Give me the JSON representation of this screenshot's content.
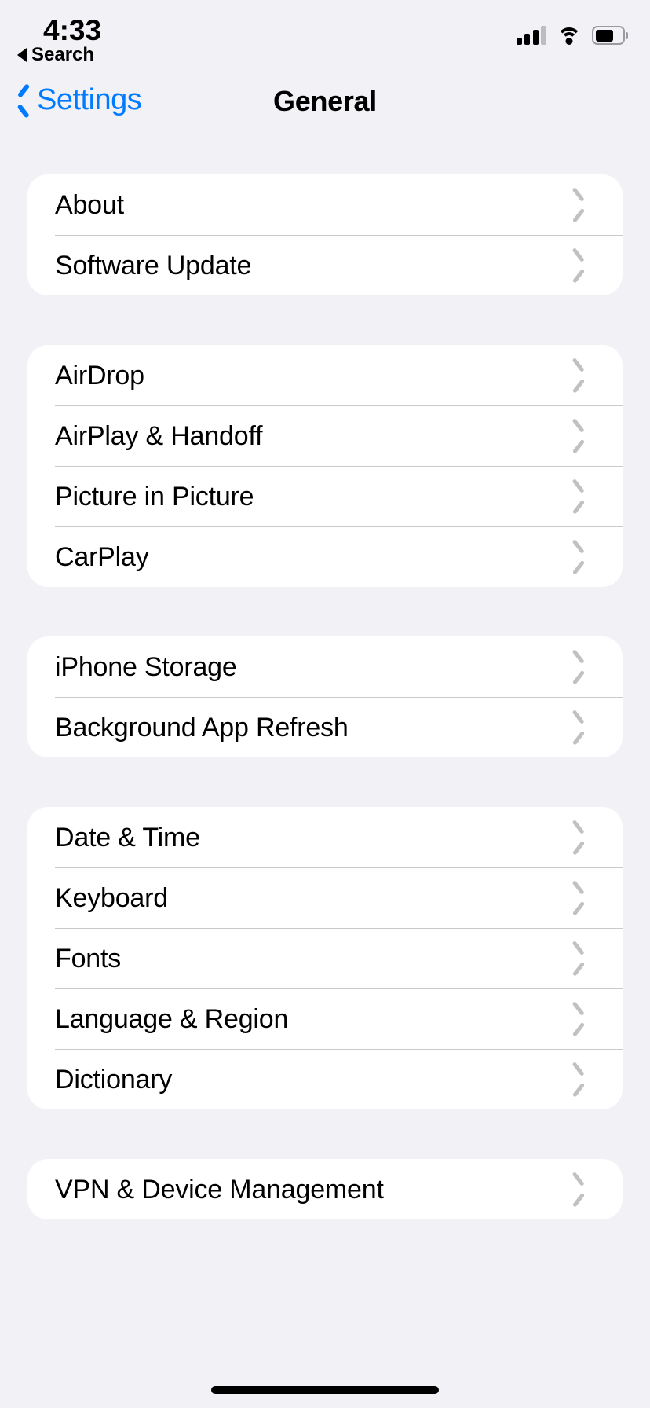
{
  "status_bar": {
    "time": "4:33",
    "back_to_app_label": "Search",
    "back_triangle_icon": "back-triangle-icon",
    "cellular_icon": "cellular-signal-icon",
    "cellular_bars_filled": 3,
    "cellular_bars_total": 4,
    "wifi_icon": "wifi-icon",
    "battery_icon": "battery-icon",
    "battery_level_percent": 62
  },
  "nav_bar": {
    "back_label": "Settings",
    "back_chevron_icon": "chevron-left-icon",
    "title": "General"
  },
  "colors": {
    "accent_blue": "#007AFF",
    "page_background": "#F2F1F6",
    "card_background": "#FFFFFF",
    "separator": "#C9C9CC",
    "chevron_gray": "#C1C1C4",
    "label_black": "#000000"
  },
  "groups": [
    {
      "rows": [
        {
          "label": "About",
          "chevron": "chevron-right-icon"
        },
        {
          "label": "Software Update",
          "chevron": "chevron-right-icon"
        }
      ]
    },
    {
      "rows": [
        {
          "label": "AirDrop",
          "chevron": "chevron-right-icon"
        },
        {
          "label": "AirPlay & Handoff",
          "chevron": "chevron-right-icon"
        },
        {
          "label": "Picture in Picture",
          "chevron": "chevron-right-icon"
        },
        {
          "label": "CarPlay",
          "chevron": "chevron-right-icon"
        }
      ]
    },
    {
      "rows": [
        {
          "label": "iPhone Storage",
          "chevron": "chevron-right-icon"
        },
        {
          "label": "Background App Refresh",
          "chevron": "chevron-right-icon"
        }
      ]
    },
    {
      "rows": [
        {
          "label": "Date & Time",
          "chevron": "chevron-right-icon"
        },
        {
          "label": "Keyboard",
          "chevron": "chevron-right-icon"
        },
        {
          "label": "Fonts",
          "chevron": "chevron-right-icon"
        },
        {
          "label": "Language & Region",
          "chevron": "chevron-right-icon"
        },
        {
          "label": "Dictionary",
          "chevron": "chevron-right-icon"
        }
      ]
    },
    {
      "rows": [
        {
          "label": "VPN & Device Management",
          "chevron": "chevron-right-icon"
        }
      ]
    }
  ],
  "home_indicator": "home-indicator"
}
